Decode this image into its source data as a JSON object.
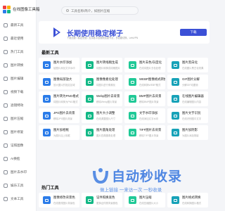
{
  "app": {
    "title": "在线图像工具箱"
  },
  "colors": {
    "brand": "#3b50d6",
    "watermark": "#3d7be0"
  },
  "sidebar": {
    "items": [
      {
        "label": "最新工具",
        "icon": "new-icon"
      },
      {
        "label": "最近使用",
        "icon": "history-icon"
      },
      {
        "label": "热门工具",
        "icon": "fire-icon"
      },
      {
        "label": "图片转换",
        "icon": "convert-icon"
      },
      {
        "label": "图片编辑",
        "icon": "edit-icon"
      },
      {
        "label": "视频下载",
        "icon": "download-icon"
      },
      {
        "label": "滤镜特效",
        "icon": "filter-icon"
      },
      {
        "label": "图片压缩",
        "icon": "compress-icon"
      },
      {
        "label": "图片修复",
        "icon": "repair-icon"
      },
      {
        "label": "证照图像",
        "icon": "id-photo-icon"
      },
      {
        "label": "AI换脸",
        "icon": "face-icon"
      },
      {
        "label": "图片去水印",
        "icon": "watermark-icon"
      },
      {
        "label": "娱乐工具",
        "icon": "fun-icon"
      },
      {
        "label": "文本工具",
        "icon": "text-icon"
      }
    ]
  },
  "search": {
    "placeholder": "工具名称/简介，如图片压缩"
  },
  "banner": {
    "title": "长期使用稳定梯子",
    "subtitle": "下载加速 • 稳定快速 • 支持各平台使用加速节点，多线路切换，LetsVPN",
    "button": "下载"
  },
  "sections": [
    {
      "title": "最新工具",
      "cards": [
        {
          "name": "图片水印添加",
          "desc": "给图片添加文字水印",
          "color": "#2b7ce9"
        },
        {
          "name": "图片转线稿生成",
          "desc": "将图片转换成线稿图片",
          "color": "#12b886"
        },
        {
          "name": "图片去色/灰度化",
          "desc": "在线将图片去色处理",
          "color": "#20c997"
        },
        {
          "name": "图片黑白化",
          "desc": "在线图片黑白化效果",
          "color": "#17a2b8"
        },
        {
          "name": "图像局部放大",
          "desc": "放大图片的指定区域",
          "color": "#2b7ce9"
        },
        {
          "name": "图像像素化处理",
          "desc": "将图片进行像素化",
          "color": "#12b886"
        },
        {
          "name": "WEBP图像格式转换",
          "desc": "在线转换WEBP格式",
          "color": "#20c997"
        },
        {
          "name": "GIF图片分解",
          "desc": "分解GIF动图帧",
          "color": "#17a2b8"
        },
        {
          "name": "图片转为PNG格式",
          "desc": "将图片转换为PNG格式",
          "color": "#2b7ce9"
        },
        {
          "name": "Webp图片去背景",
          "desc": "移除Webp图片背景",
          "color": "#12b886"
        },
        {
          "name": "BMP图片去背景",
          "desc": "移除BMP图片背景",
          "color": "#20c997"
        },
        {
          "name": "在线图片编辑器",
          "desc": "在线编辑图片内容",
          "color": "#17a2b8"
        },
        {
          "name": "JPG图片去背景",
          "desc": "移除JPG图片背景",
          "color": "#2b7ce9"
        },
        {
          "name": "图片大小调整",
          "desc": "在线调整图片尺寸",
          "color": "#12b886"
        },
        {
          "name": "文字水印添加",
          "desc": "在线添加文字水印",
          "color": "#20c997"
        },
        {
          "name": "图片文字识别",
          "desc": "在线识别图中文字",
          "color": "#17a2b8"
        },
        {
          "name": "图片加相框",
          "desc": "为图片加上相框",
          "color": "#2b7ce9"
        },
        {
          "name": "图片圆角处理",
          "desc": "图片四角圆角处理",
          "color": "#12b886"
        },
        {
          "name": "TIFF图片去背景",
          "desc": "移除TIFF图片背景",
          "color": "#20c997"
        },
        {
          "name": "图片加阴影",
          "desc": "为图片添加阴影",
          "color": "#17a2b8"
        }
      ]
    },
    {
      "title": "热门工具",
      "cards": [
        {
          "name": "图像修改背景色",
          "desc": "在线更改图片背景色",
          "color": "#2b7ce9"
        },
        {
          "name": "证件照换底色",
          "desc": "更换证件照背景颜色",
          "color": "#12b886"
        },
        {
          "name": "图片压缩",
          "desc": "在线压缩图片大小",
          "color": "#20c997"
        },
        {
          "name": "图片格式转换",
          "desc": "在线转换图片格式",
          "color": "#17a2b8"
        }
      ]
    }
  ],
  "watermark": {
    "title": "自动秒收录",
    "subtitle": "做上链接 一来访一次 一秒收录"
  }
}
